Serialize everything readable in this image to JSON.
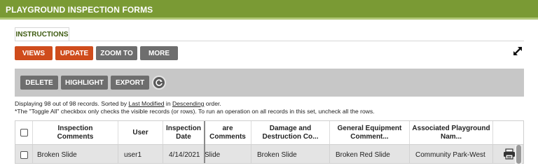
{
  "header": {
    "title": "PLAYGROUND INSPECTION FORMS"
  },
  "tabs": {
    "instructions": "INSTRUCTIONS"
  },
  "toolbar": {
    "views": "VIEWS",
    "update": "UPDATE",
    "zoom_to": "ZOOM TO",
    "more": "MORE",
    "expand_icon": "expand-arrows-icon"
  },
  "actions": {
    "delete": "DELETE",
    "highlight": "HIGHLIGHT",
    "export": "EXPORT",
    "refresh_icon": "refresh-icon"
  },
  "info": {
    "display_prefix": "Displaying 98 out of 98 records. Sorted by ",
    "sort_field": "Last Modified",
    "sort_mid": " in ",
    "sort_order": "Descending",
    "sort_suffix": " order.",
    "note": "*The \"Toggle All\" checkbox only checks the visible records (or rows). To run an operation on all records in this set, uncheck all the rows."
  },
  "table": {
    "headers": {
      "inspection_comments": [
        "Inspection",
        "Comments"
      ],
      "user": "User",
      "inspection_date": [
        "Inspection",
        "Date"
      ],
      "are_comments": "are Comments",
      "damage": [
        "Damage and",
        "Destruction Co..."
      ],
      "general_equipment": [
        "General Equipment",
        "Comment..."
      ],
      "associated_playground": [
        "Associated Playground",
        "Nam..."
      ]
    },
    "rows": [
      {
        "inspection_comments": "Broken Slide",
        "user": "user1",
        "inspection_date": "4/14/2021",
        "are_comments": "Slide",
        "damage": "Broken Slide",
        "general_equipment": "Broken Red Slide",
        "associated_playground": "Community Park-West",
        "print_icon": "print-icon"
      }
    ]
  },
  "colors": {
    "header_bg": "#7a9a34",
    "accent_red": "#cf4c1c",
    "button_gray": "#6e6e6e"
  }
}
